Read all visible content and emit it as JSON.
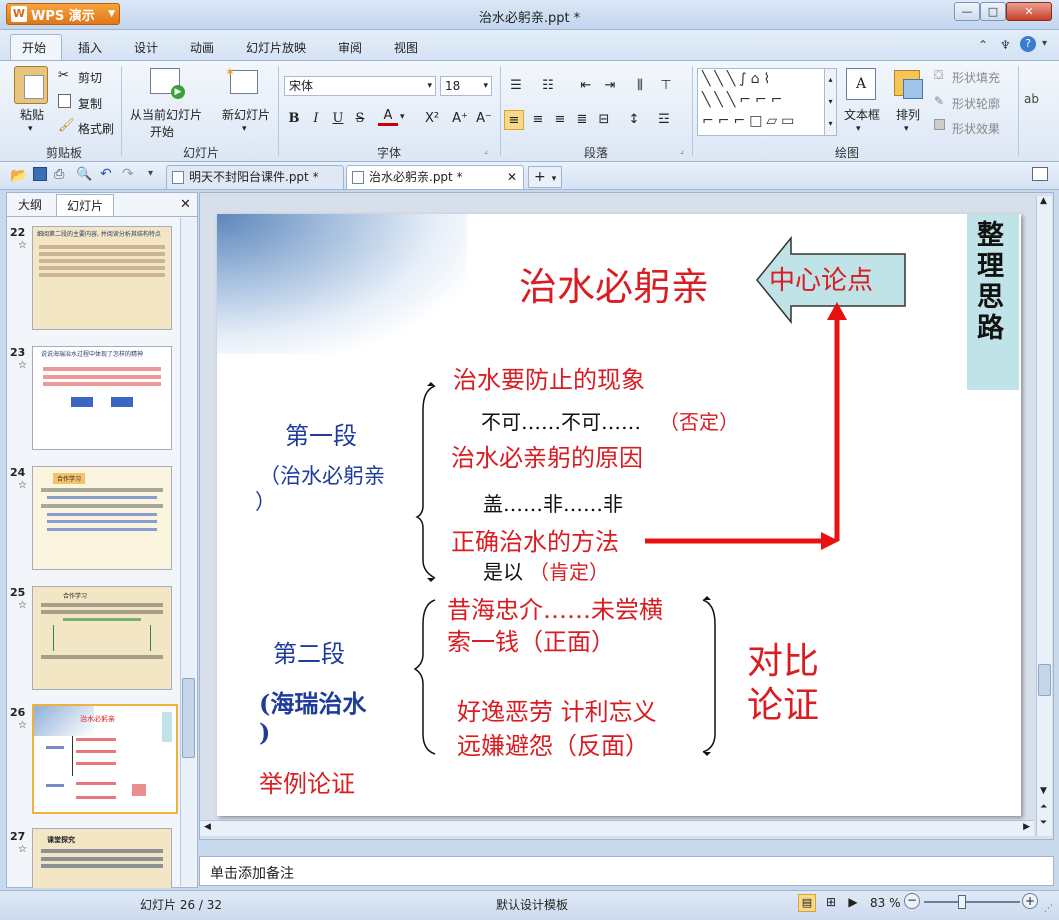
{
  "app": {
    "name": "WPS 演示",
    "window_title": "治水必躬亲.ppt *"
  },
  "window_controls": {
    "minimize": "—",
    "maximize": "□",
    "close": "✕"
  },
  "menu": {
    "tabs": [
      "开始",
      "插入",
      "设计",
      "动画",
      "幻灯片放映",
      "审阅",
      "视图"
    ],
    "active": "开始"
  },
  "ribbon": {
    "clipboard": {
      "paste": "粘贴",
      "cut": "剪切",
      "copy": "复制",
      "format_painter": "格式刷",
      "group": "剪贴板"
    },
    "slides": {
      "from_current": "从当前幻灯片",
      "from_current_2": "开始",
      "new_slide": "新幻灯片",
      "group": "幻灯片"
    },
    "font": {
      "name": "宋体",
      "size": "18",
      "bold": "B",
      "italic": "I",
      "underline": "U",
      "strike": "S",
      "color": "A",
      "superscript": "X²",
      "grow": "A⁺",
      "shrink": "A⁻",
      "group": "字体"
    },
    "paragraph": {
      "group": "段落"
    },
    "drawing": {
      "textbox": "文本框",
      "arrange": "排列",
      "fill": "形状填充",
      "outline": "形状轮廓",
      "effect": "形状效果",
      "group": "绘图"
    }
  },
  "doc_tabs": [
    {
      "label": "明天不封阳台课件.ppt *"
    },
    {
      "label": "治水必躬亲.ppt *"
    }
  ],
  "left_pane": {
    "tabs": [
      "大纲",
      "幻灯片"
    ],
    "thumbs": [
      {
        "num": "22",
        "title": "细阅第二段的主要内容, 并阅读分析其结构特点"
      },
      {
        "num": "23",
        "title": "说说海瑞治水过程中体现了怎样的精神"
      },
      {
        "num": "24",
        "title": "合作学习"
      },
      {
        "num": "25",
        "title": "合作学习"
      },
      {
        "num": "26",
        "title": "治水必躬亲"
      },
      {
        "num": "27",
        "title": "课堂探究"
      }
    ]
  },
  "slide": {
    "title": "治水必躬亲",
    "callout": "中心论点",
    "side_label": "整理思路",
    "p1_label": "第一段",
    "p1_sub": "（治水必躬亲",
    "p1_sub2": "）",
    "r1": "治水要防止的现象",
    "r1b": "不可……不可……",
    "r1b_note": "（否定）",
    "r2": "治水必亲躬的原因",
    "r2b": "盖……非……非",
    "r3": "正确治水的方法",
    "r3b": "是以",
    "r3b_note": "（肯定）",
    "p2_label": "第二段",
    "p2_sub": "(海瑞治水",
    "p2_sub2": ")",
    "p2_method": "举例论证",
    "s1a": "昔海忠介……未尝横",
    "s1b": "索一钱（正面）",
    "s2a": "好逸恶劳  计利忘义",
    "s2b": "远嫌避怨（反面）",
    "contrast1": "对比",
    "contrast2": "论证"
  },
  "notes": "单击添加备注",
  "status": {
    "slide": "幻灯片 26 / 32",
    "template": "默认设计模板",
    "zoom": "83 %"
  },
  "colors": {
    "accent_red": "#d91d22",
    "text_blue": "#1f3b9c",
    "callout_bg": "#bfe3e6"
  }
}
